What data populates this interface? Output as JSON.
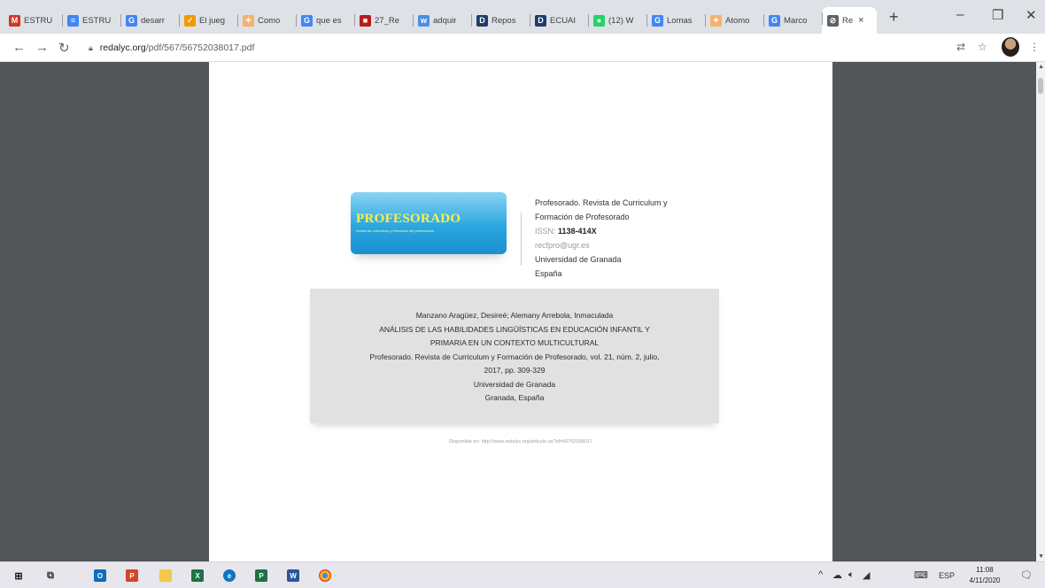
{
  "browser": {
    "tabs": [
      {
        "label": "ESTRU",
        "icon": "gmail-icon",
        "color": "#d93025",
        "glyph": "M"
      },
      {
        "label": "ESTRU",
        "icon": "docs-icon",
        "color": "#4285f4",
        "glyph": "≡"
      },
      {
        "label": "desarr",
        "icon": "google-icon",
        "color": "#4285f4",
        "glyph": "G"
      },
      {
        "label": "El jueg",
        "icon": "site-icon",
        "color": "#f29900",
        "glyph": "✓"
      },
      {
        "label": "Como",
        "icon": "site-icon",
        "color": "#f6b26b",
        "glyph": "✦"
      },
      {
        "label": "que es",
        "icon": "google-icon",
        "color": "#4285f4",
        "glyph": "G"
      },
      {
        "label": "27_Re",
        "icon": "pdf-icon",
        "color": "#b71c1c",
        "glyph": "■"
      },
      {
        "label": "adquir",
        "icon": "site-icon",
        "color": "#4a90e2",
        "glyph": "w"
      },
      {
        "label": "Repos",
        "icon": "site-icon",
        "color": "#1d3c6b",
        "glyph": "D"
      },
      {
        "label": "ECUAI",
        "icon": "site-icon",
        "color": "#1d3c6b",
        "glyph": "D"
      },
      {
        "label": "(12) W",
        "icon": "whatsapp-icon",
        "color": "#25d366",
        "glyph": "●"
      },
      {
        "label": "Lomas",
        "icon": "google-icon",
        "color": "#4285f4",
        "glyph": "G"
      },
      {
        "label": "Atomo",
        "icon": "site-icon",
        "color": "#f6b26b",
        "glyph": "✦"
      },
      {
        "label": "Marco",
        "icon": "google-icon",
        "color": "#4285f4",
        "glyph": "G"
      },
      {
        "label": "Re",
        "icon": "globe-icon",
        "color": "#5f6368",
        "glyph": "⊘",
        "active": true
      }
    ],
    "new_tab": "+",
    "address": {
      "domain": "redalyc.org",
      "path": "/pdf/567/56752038017.pdf"
    }
  },
  "pdf": {
    "logo_title": "PROFESORADO",
    "logo_subtitle": "revista de currículum y formación del profesorado",
    "journal": {
      "name_line1": "Profesorado. Revista de Curriculum y",
      "name_line2": "Formación de Profesorado",
      "issn_label": "ISSN:",
      "issn_value": "1138-414X",
      "email": "recfpro@ugr.es",
      "institution": "Universidad de Granada",
      "country": "España"
    },
    "citation": {
      "authors": "Manzano Aragüez, Desireé; Alemany Arrebola, Inmaculada",
      "title_line1": "ANÁLISIS DE LAS HABILIDADES LINGÜÍSTICAS EN EDUCACIÓN INFANTIL Y",
      "title_line2": "PRIMARIA EN UN CONTEXTO MULTICULTURAL",
      "source_line1": "Profesorado. Revista de Curriculum y Formación de Profesorado, vol. 21, núm. 2, julio,",
      "source_line2": "2017, pp. 309-329",
      "institution": "Universidad de Granada",
      "location": "Granada, España"
    },
    "available_at": "Disponible en: http://www.redalyc.org/articulo.oa?id=56752038017"
  },
  "taskbar": {
    "language": "ESP",
    "time": "11:08",
    "date": "4/11/2020"
  }
}
